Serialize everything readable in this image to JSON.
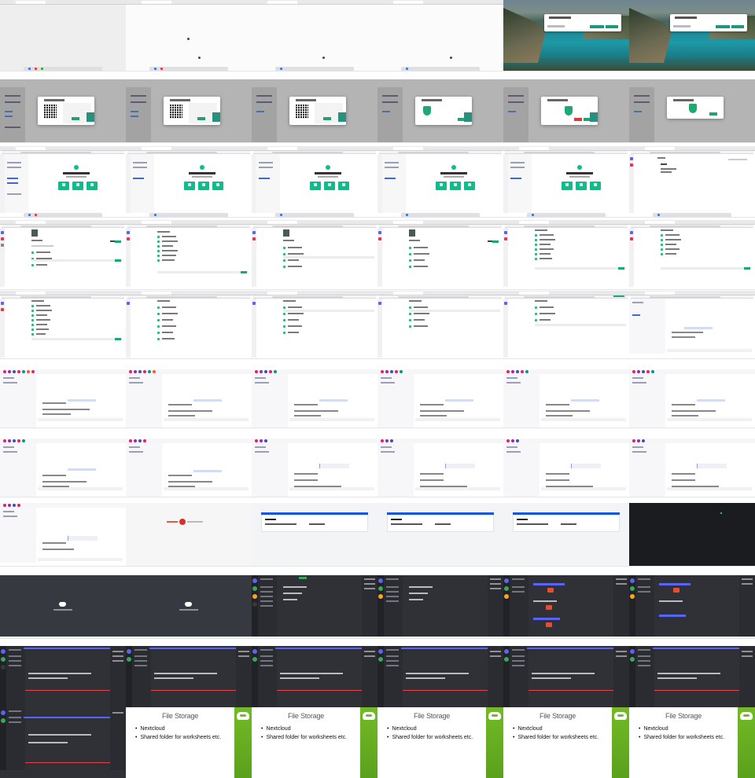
{
  "slide": {
    "title": "File Storage",
    "bullets": [
      "Nextcloud",
      "Shared folder for worksheets etc."
    ]
  },
  "colors": {
    "element_green": "#0dbd8b",
    "discord_blurple": "#5865f2",
    "discord_dark": "#2f3136",
    "opensuse_green": "#73ba25",
    "danger_red": "#e0353d"
  },
  "icons": [
    "shield-icon",
    "qr-code-icon",
    "discord-logo-icon",
    "gecko-logo-icon",
    "tomato-icon"
  ]
}
